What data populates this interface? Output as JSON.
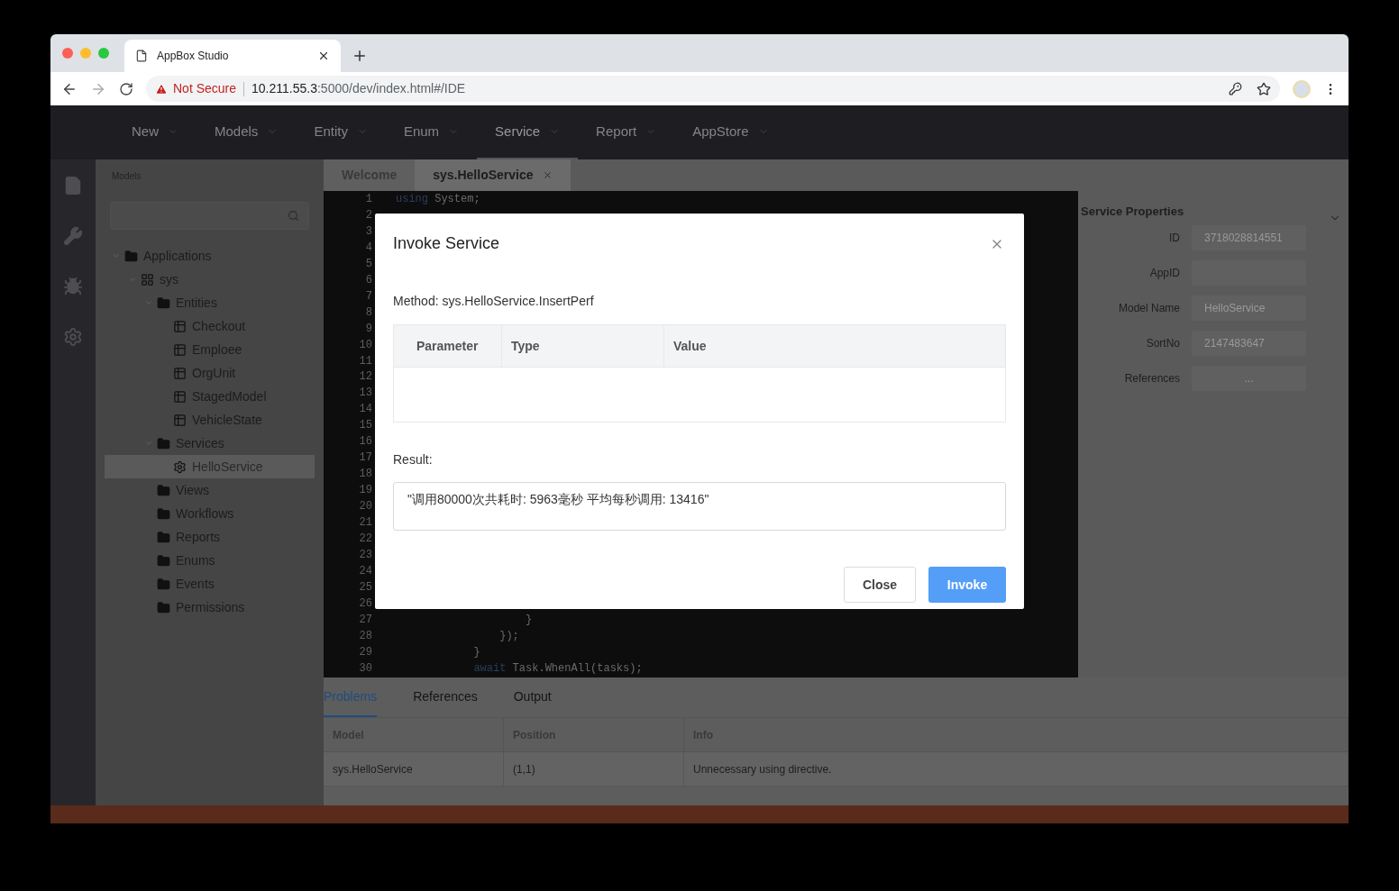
{
  "browser": {
    "tab": {
      "title": "AppBox Studio"
    },
    "security": "Not Secure",
    "url_host": "10.211.55.3",
    "url_path": ":5000/dev/index.html#/IDE",
    "forward_disabled": true
  },
  "nav": [
    {
      "label": "New",
      "selected": false
    },
    {
      "label": "Models",
      "selected": false
    },
    {
      "label": "Entity",
      "selected": false
    },
    {
      "label": "Enum",
      "selected": false
    },
    {
      "label": "Service",
      "selected": true
    },
    {
      "label": "Report",
      "selected": false
    },
    {
      "label": "AppStore",
      "selected": false
    }
  ],
  "sidebar_tools": [
    {
      "kind": "file"
    },
    {
      "kind": "wrench"
    },
    {
      "kind": "bug"
    },
    {
      "kind": "settings"
    }
  ],
  "sidebar": {
    "title": "Models",
    "tree": [
      {
        "label": "Applications",
        "kind": "folder",
        "expanded": true,
        "selected": false,
        "children": [
          {
            "label": "sys",
            "kind": "app",
            "expanded": true,
            "selected": false,
            "children": [
              {
                "label": "Entities",
                "kind": "folder",
                "expanded": true,
                "selected": false,
                "children": [
                  {
                    "label": "Checkout",
                    "kind": "entity",
                    "selected": false
                  },
                  {
                    "label": "Emploee",
                    "kind": "entity",
                    "selected": false
                  },
                  {
                    "label": "OrgUnit",
                    "kind": "entity",
                    "selected": false
                  },
                  {
                    "label": "StagedModel",
                    "kind": "entity",
                    "selected": false
                  },
                  {
                    "label": "VehicleState",
                    "kind": "entity",
                    "selected": false
                  }
                ]
              },
              {
                "label": "Services",
                "kind": "folder",
                "expanded": true,
                "selected": false,
                "children": [
                  {
                    "label": "HelloService",
                    "kind": "service",
                    "selected": true
                  }
                ]
              },
              {
                "label": "Views",
                "kind": "folder",
                "selected": false
              },
              {
                "label": "Workflows",
                "kind": "folder",
                "selected": false
              },
              {
                "label": "Reports",
                "kind": "folder",
                "selected": false
              },
              {
                "label": "Enums",
                "kind": "folder",
                "selected": false
              },
              {
                "label": "Events",
                "kind": "folder",
                "selected": false
              },
              {
                "label": "Permissions",
                "kind": "folder",
                "selected": false
              }
            ]
          }
        ]
      }
    ]
  },
  "editor_tabs": [
    {
      "label": "Welcome",
      "selected": false,
      "closable": false
    },
    {
      "label": "sys.HelloService",
      "selected": true,
      "closable": true
    }
  ],
  "editor": {
    "lines": [
      {
        "number": "1",
        "code": [
          {
            "kind": "keyword",
            "text": "using"
          },
          {
            "kind": "plain",
            "text": " System;"
          }
        ]
      },
      {
        "number": "2"
      },
      {
        "number": "3"
      },
      {
        "number": "4"
      },
      {
        "number": "5"
      },
      {
        "number": "6"
      },
      {
        "number": "7"
      },
      {
        "number": "8"
      },
      {
        "number": "9"
      },
      {
        "number": "10"
      },
      {
        "number": "11"
      },
      {
        "number": "12"
      },
      {
        "number": "13"
      },
      {
        "number": "14"
      },
      {
        "number": "15"
      },
      {
        "number": "16"
      },
      {
        "number": "17"
      },
      {
        "number": "18"
      },
      {
        "number": "19"
      },
      {
        "number": "20"
      },
      {
        "number": "21"
      },
      {
        "number": "22"
      },
      {
        "number": "23"
      },
      {
        "number": "24"
      },
      {
        "number": "25"
      },
      {
        "number": "26"
      },
      {
        "number": "27",
        "code": [
          {
            "kind": "plain",
            "text": "                    }"
          }
        ]
      },
      {
        "number": "28",
        "code": [
          {
            "kind": "plain",
            "text": "                });"
          }
        ]
      },
      {
        "number": "29",
        "code": [
          {
            "kind": "plain",
            "text": "            }"
          }
        ]
      },
      {
        "number": "30",
        "code": [
          {
            "kind": "keyword",
            "text": "            await"
          },
          {
            "kind": "plain",
            "text": " Task.WhenAll(tasks);"
          }
        ]
      }
    ]
  },
  "properties": {
    "title": "Service Properties",
    "fields": [
      {
        "label": "ID",
        "value": "3718028814551"
      },
      {
        "label": "AppID"
      },
      {
        "label": "Model Name",
        "value": "HelloService"
      },
      {
        "label": "SortNo",
        "value": "2147483647"
      },
      {
        "label": "References",
        "value": "...",
        "kind": "button"
      }
    ]
  },
  "bottom_tabs": [
    {
      "label": "Problems",
      "selected": true
    },
    {
      "label": "References",
      "selected": false
    },
    {
      "label": "Output",
      "selected": false
    }
  ],
  "problems": {
    "columns": [
      "Model",
      "Position",
      "Info"
    ],
    "rows": [
      [
        "sys.HelloService",
        "(1,1)",
        "Unnecessary using directive."
      ]
    ]
  },
  "dialog": {
    "title": "Invoke Service",
    "method": "Method: sys.HelloService.InsertPerf",
    "columns": [
      "Parameter",
      "Type",
      "Value"
    ],
    "result_label": "Result:",
    "result": "\"调用80000次共耗时: 5963毫秒 平均每秒调用: 13416\"",
    "buttons": [
      {
        "label": "Close",
        "kind": "default"
      },
      {
        "label": "Invoke",
        "kind": "primary"
      }
    ]
  }
}
